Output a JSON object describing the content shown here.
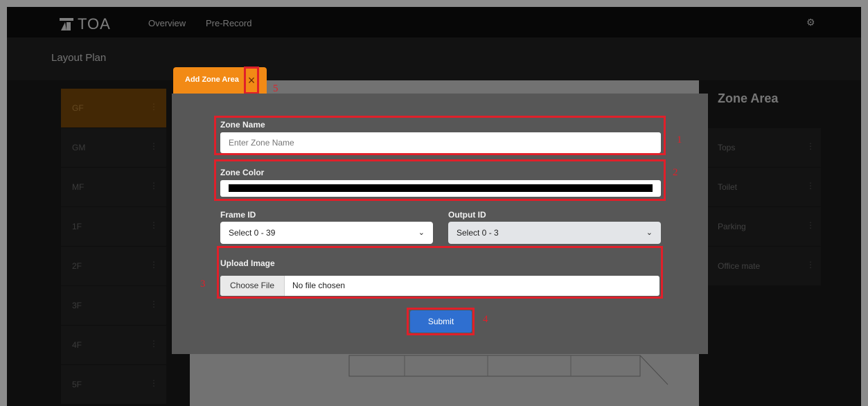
{
  "header": {
    "logo_text": "TOA",
    "nav": [
      "Overview",
      "Pre-Record"
    ],
    "settings_icon": "gear-icon"
  },
  "subheader": {
    "title": "Layout Plan"
  },
  "floors": [
    "GF",
    "GM",
    "MF",
    "1F",
    "2F",
    "3F",
    "4F",
    "5F"
  ],
  "active_floor": "GF",
  "zone_panel": {
    "title": "Zone Area",
    "items": [
      "Tops",
      "Toilet",
      "Parking",
      "Office mate"
    ]
  },
  "modal": {
    "tab_label": "Add Zone Area",
    "close_label": "×",
    "zone_name": {
      "label": "Zone Name",
      "placeholder": "Enter Zone Name"
    },
    "zone_color": {
      "label": "Zone Color",
      "value": "#000000"
    },
    "frame_id": {
      "label": "Frame ID",
      "selected": "Select 0 - 39"
    },
    "output_id": {
      "label": "Output ID",
      "selected": "Select 0 - 3"
    },
    "upload": {
      "label": "Upload Image",
      "button": "Choose File",
      "status": "No file chosen"
    },
    "submit_label": "Submit"
  },
  "annotations": [
    "1",
    "2",
    "3",
    "4",
    "5"
  ]
}
